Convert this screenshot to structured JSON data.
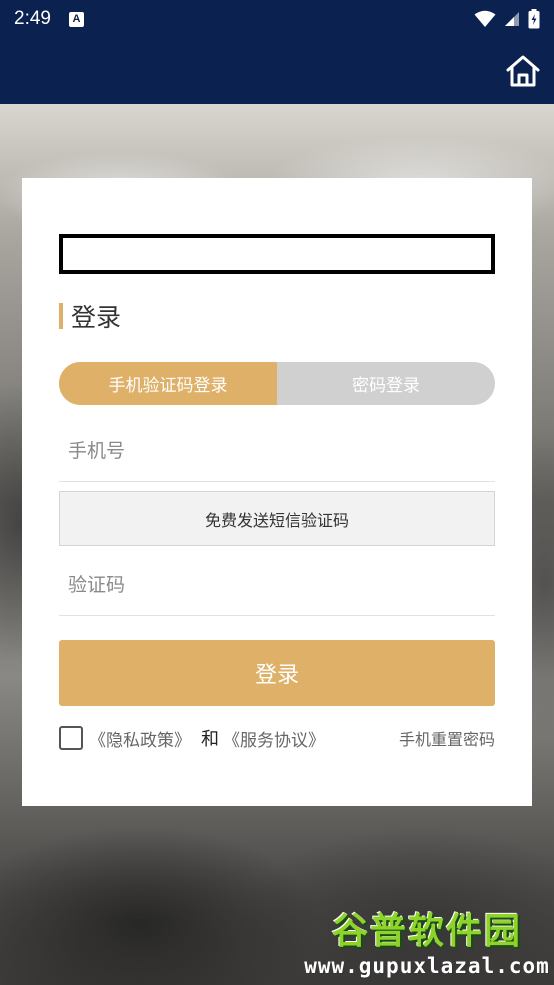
{
  "status_bar": {
    "time": "2:49",
    "notification_icon_letter": "A",
    "icons": [
      "wifi-icon",
      "signal-icon",
      "battery-icon"
    ]
  },
  "header": {
    "home_icon": "home-icon"
  },
  "login": {
    "title": "登录",
    "tabs": [
      {
        "label": "手机验证码登录",
        "active": true
      },
      {
        "label": "密码登录",
        "active": false
      }
    ],
    "phone_placeholder": "手机号",
    "sms_button_label": "免费发送短信验证码",
    "code_placeholder": "验证码",
    "submit_label": "登录",
    "privacy_link": "《隐私政策》",
    "and_text": "和",
    "service_link": "《服务协议》",
    "reset_link": "手机重置密码"
  },
  "watermark": {
    "title": "谷普软件园",
    "url": "www.gupuxlazal.com"
  },
  "colors": {
    "header_bg": "#0b2150",
    "accent": "#deb068",
    "inactive_tab": "#d0d0d0"
  }
}
